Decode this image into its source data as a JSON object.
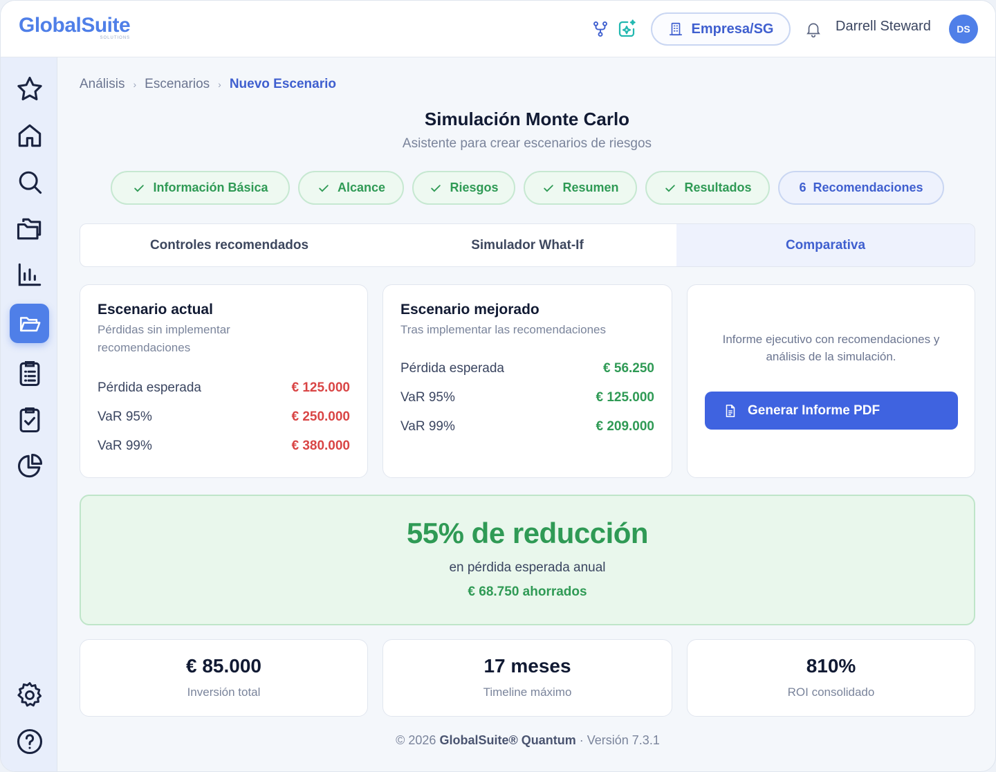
{
  "header": {
    "logo": "GlobalSuite",
    "logo_sub": "SOLUTIONS",
    "org_button": "Empresa/SG",
    "user_name": "Darrell Steward",
    "user_initials": "DS"
  },
  "breadcrumb": [
    "Análisis",
    "Escenarios",
    "Nuevo Escenario"
  ],
  "page": {
    "title": "Simulación Monte Carlo",
    "subtitle": "Asistente para crear escenarios de riesgos"
  },
  "steps": [
    {
      "label": "Información Básica",
      "state": "done"
    },
    {
      "label": "Alcance",
      "state": "done"
    },
    {
      "label": "Riesgos",
      "state": "done"
    },
    {
      "label": "Resumen",
      "state": "done"
    },
    {
      "label": "Resultados",
      "state": "done"
    },
    {
      "number": "6",
      "label": "Recomendaciones",
      "state": "current"
    }
  ],
  "tabs": [
    "Controles recomendados",
    "Simulador What-If",
    "Comparativa"
  ],
  "active_tab": "Comparativa",
  "current_scenario": {
    "title": "Escenario actual",
    "description": "Pérdidas sin implementar recomendaciones",
    "metrics": [
      {
        "label": "Pérdida esperada",
        "value": "€ 125.000"
      },
      {
        "label": "VaR 95%",
        "value": "€ 250.000"
      },
      {
        "label": "VaR 99%",
        "value": "€ 380.000"
      }
    ]
  },
  "improved_scenario": {
    "title": "Escenario mejorado",
    "description": "Tras implementar las recomendaciones",
    "metrics": [
      {
        "label": "Pérdida esperada",
        "value": "€ 56.250"
      },
      {
        "label": "VaR 95%",
        "value": "€ 125.000"
      },
      {
        "label": "VaR 99%",
        "value": "€ 209.000"
      }
    ]
  },
  "report": {
    "text": "Informe ejecutivo con recomendaciones y análisis de la simulación.",
    "button": "Generar Informe PDF"
  },
  "reduction": {
    "headline": "55% de reducción",
    "subtext": "en pérdida esperada anual",
    "savings": "€ 68.750 ahorrados"
  },
  "kpis": [
    {
      "value": "€ 85.000",
      "label": "Inversión total"
    },
    {
      "value": "17 meses",
      "label": "Timeline máximo"
    },
    {
      "value": "810%",
      "label": "ROI consolidado"
    }
  ],
  "footer": {
    "prefix": "© 2026",
    "product": "GlobalSuite® Quantum",
    "version": "· Versión 7.3.1"
  },
  "sidebar_icons": [
    "star-icon",
    "home-icon",
    "search-icon",
    "folders-icon",
    "bar-chart-icon",
    "folder-open-icon",
    "clipboard-list-icon",
    "clipboard-check-icon",
    "pie-chart-icon",
    "gear-icon",
    "help-icon"
  ],
  "colors": {
    "accent": "#4f7fe8",
    "primary_button": "#3f63e0",
    "success": "#2f9a55",
    "danger": "#d94545"
  }
}
